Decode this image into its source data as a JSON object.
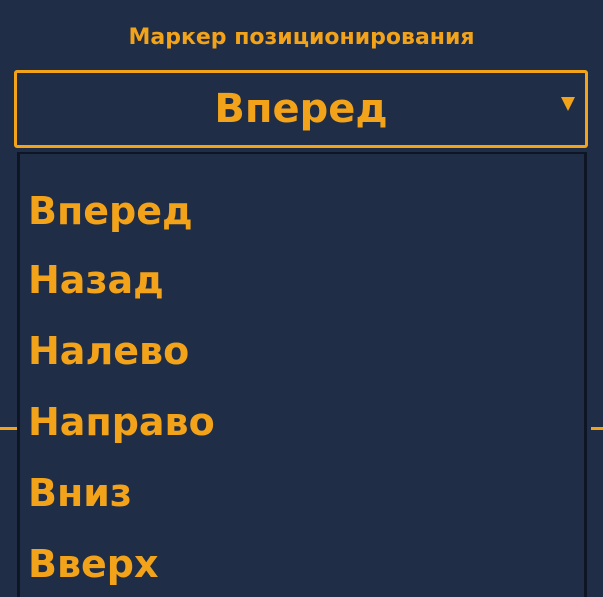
{
  "panel": {
    "title": "Маркер позиционирования"
  },
  "select": {
    "value": "Вперед",
    "caret_icon": "triangle-down-icon",
    "options": [
      "Вперед",
      "Назад",
      "Налево",
      "Направо",
      "Вниз",
      "Вверх"
    ]
  },
  "colors": {
    "accent": "#f2a31a",
    "background": "#1f2d47",
    "border_dark": "#0e1524"
  }
}
